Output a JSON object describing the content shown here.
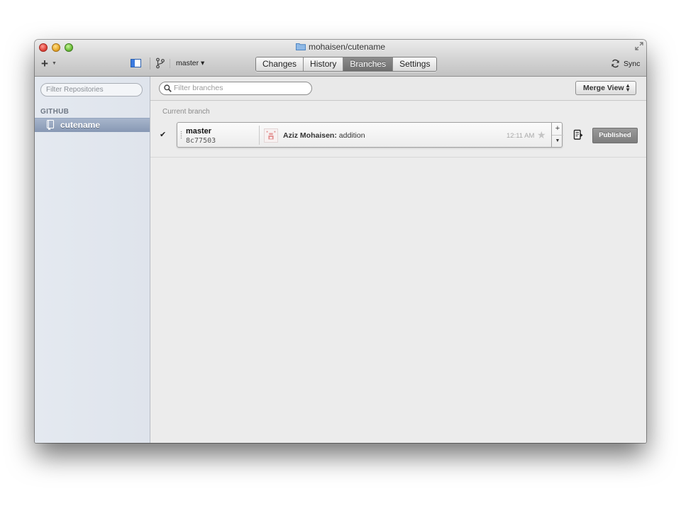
{
  "window": {
    "title": "mohaisen/cutename"
  },
  "toolbar": {
    "add_symbol": "+",
    "add_caret": "▼",
    "branch_selector": "master ▾",
    "tabs": [
      {
        "label": "Changes",
        "active": false
      },
      {
        "label": "History",
        "active": false
      },
      {
        "label": "Branches",
        "active": true
      },
      {
        "label": "Settings",
        "active": false
      }
    ],
    "sync_label": "Sync"
  },
  "sidebar": {
    "filter_placeholder": "Filter Repositories",
    "section_header": "GITHUB",
    "items": [
      {
        "label": "cutename",
        "selected": true
      }
    ]
  },
  "main": {
    "filter_placeholder": "Filter branches",
    "merge_view_label": "Merge View",
    "current_branch_label": "Current branch",
    "branch": {
      "check": "✔",
      "name": "master",
      "sha": "8c77503",
      "commit_author": "Aziz Mohaisen:",
      "commit_message": " addition",
      "commit_time": "12:11 AM",
      "star": "★",
      "stepper_up": "+",
      "stepper_down": "▼",
      "status_label": "Published"
    }
  },
  "colors": {
    "selected_row": "#8798b4",
    "active_tab": "#7a7a7a",
    "published_button": "#8a8a8a"
  }
}
